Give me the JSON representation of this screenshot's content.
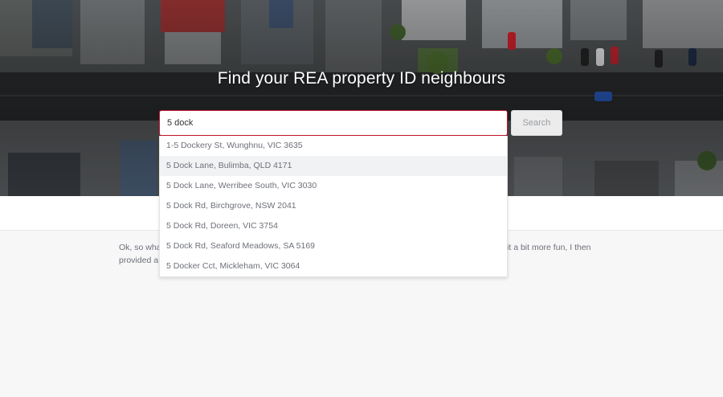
{
  "hero": {
    "title": "Find your REA property ID neighbours"
  },
  "search": {
    "value": "5 dock",
    "button_label": "Search"
  },
  "suggestions": [
    "1-5 Dockery St, Wunghnu, VIC 3635",
    "5 Dock Lane, Bulimba, QLD 4171",
    "5 Dock Lane, Werribee South, VIC 3030",
    "5 Dock Rd, Birchgrove, NSW 2041",
    "5 Dock Rd, Doreen, VIC 3754",
    "5 Dock Rd, Seaford Meadows, SA 5169",
    "5 Docker Cct, Mickleham, VIC 3064"
  ],
  "active_suggestion_index": 1,
  "intro": {
    "text": "Ok, so wha… n internet trend of texting the phone … h REA Property IDs. Every property in … To make it a bit more fun, I then provided a quiz about your neighbours with a maximum possible score of 1200. Have fun!"
  },
  "colors": {
    "accent_border": "#c4132c",
    "text_muted": "#6d7078",
    "page_background": "#f7f7f8"
  }
}
